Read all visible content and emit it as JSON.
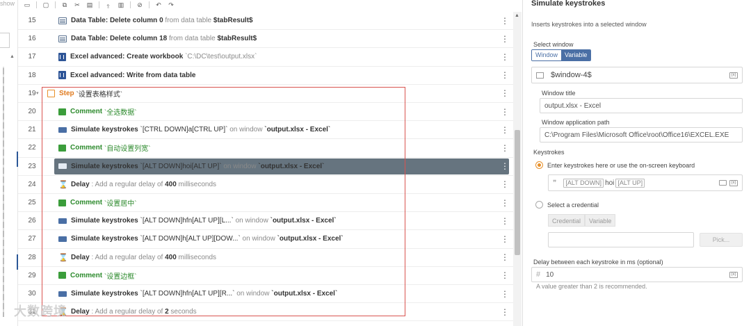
{
  "left": {
    "show_label": "show"
  },
  "rows": [
    {
      "num": "15",
      "icon": "table",
      "parts": [
        [
          "b",
          "Data Table: Delete column 0"
        ],
        [
          "g",
          " from data table "
        ],
        [
          "b",
          "$tabResult$"
        ]
      ]
    },
    {
      "num": "16",
      "icon": "table",
      "parts": [
        [
          "b",
          "Data Table: Delete column 18"
        ],
        [
          "g",
          " from data table "
        ],
        [
          "b",
          "$tabResult$"
        ]
      ]
    },
    {
      "num": "17",
      "icon": "excel",
      "parts": [
        [
          "b",
          "Excel advanced: Create workbook"
        ],
        [
          "g",
          " `C:\\DC\\test\\output.xlsx`"
        ]
      ]
    },
    {
      "num": "18",
      "icon": "excel",
      "parts": [
        [
          "b",
          "Excel advanced: Write from data table"
        ]
      ]
    },
    {
      "num": "19",
      "icon": "step",
      "caret": true,
      "parts": [
        [
          "o",
          "Step"
        ],
        [
          "n",
          " `设置表格样式`"
        ]
      ]
    },
    {
      "num": "20",
      "icon": "comment",
      "parts": [
        [
          "gr",
          "Comment"
        ],
        [
          "cs",
          " `全选数据`"
        ]
      ]
    },
    {
      "num": "21",
      "icon": "kb",
      "parts": [
        [
          "b",
          "Simulate keystrokes"
        ],
        [
          "n",
          " `[CTRL DOWN]a[CTRL UP]`"
        ],
        [
          "g",
          " on window "
        ],
        [
          "v",
          "`output.xlsx - Excel`"
        ]
      ]
    },
    {
      "num": "22",
      "icon": "comment",
      "parts": [
        [
          "gr",
          "Comment"
        ],
        [
          "cs",
          " `自动设置列宽`"
        ]
      ]
    },
    {
      "num": "23",
      "icon": "kb",
      "selected": true,
      "parts": [
        [
          "b",
          "Simulate keystrokes"
        ],
        [
          "n",
          " `[ALT DOWN]hoi[ALT UP]`"
        ],
        [
          "g",
          " on window "
        ],
        [
          "v",
          "`output.xlsx - Excel`"
        ]
      ]
    },
    {
      "num": "24",
      "icon": "delay",
      "parts": [
        [
          "b",
          "Delay"
        ],
        [
          "g",
          " : Add a regular delay of "
        ],
        [
          "v",
          "400"
        ],
        [
          "g",
          " milliseconds"
        ]
      ]
    },
    {
      "num": "25",
      "icon": "comment",
      "parts": [
        [
          "gr",
          "Comment"
        ],
        [
          "cs",
          " `设置居中`"
        ]
      ]
    },
    {
      "num": "26",
      "icon": "kb",
      "parts": [
        [
          "b",
          "Simulate keystrokes"
        ],
        [
          "n",
          " `[ALT DOWN]hfn[ALT UP][L...`"
        ],
        [
          "g",
          " on window "
        ],
        [
          "v",
          "`output.xlsx - Excel`"
        ]
      ]
    },
    {
      "num": "27",
      "icon": "kb",
      "parts": [
        [
          "b",
          "Simulate keystrokes"
        ],
        [
          "n",
          " `[ALT DOWN]h[ALT UP][DOW...`"
        ],
        [
          "g",
          " on window "
        ],
        [
          "v",
          "`output.xlsx - Excel`"
        ]
      ]
    },
    {
      "num": "28",
      "icon": "delay",
      "parts": [
        [
          "b",
          "Delay"
        ],
        [
          "g",
          " : Add a regular delay of "
        ],
        [
          "v",
          "400"
        ],
        [
          "g",
          " milliseconds"
        ]
      ]
    },
    {
      "num": "29",
      "icon": "comment",
      "parts": [
        [
          "gr",
          "Comment"
        ],
        [
          "cs",
          " `设置边框`"
        ]
      ]
    },
    {
      "num": "30",
      "icon": "kb",
      "parts": [
        [
          "b",
          "Simulate keystrokes"
        ],
        [
          "n",
          " `[ALT DOWN]hfn[ALT UP][R...`"
        ],
        [
          "g",
          " on window "
        ],
        [
          "v",
          "`output.xlsx - Excel`"
        ]
      ]
    },
    {
      "num": "31",
      "icon": "delay",
      "parts": [
        [
          "b",
          "Delay"
        ],
        [
          "g",
          " : Add a regular delay of "
        ],
        [
          "v",
          "2"
        ],
        [
          "g",
          " seconds"
        ]
      ]
    }
  ],
  "watermark": "大数跨境",
  "panel": {
    "title": "Simulate keystrokes",
    "description": "Inserts keystrokes into a selected window",
    "select_window_label": "Select window",
    "seg_window": "Window",
    "seg_variable": "Variable",
    "window_var": "$window-4$",
    "window_title_label": "Window title",
    "window_title_value": "output.xlsx - Excel",
    "app_path_label": "Window application path",
    "app_path_value": "C:\\Program Files\\Microsoft Office\\root\\Office16\\EXCEL.EXE",
    "keystrokes_label": "Keystrokes",
    "radio_enter": "Enter keystrokes here or use the on-screen keyboard",
    "ks_chip1": "[ALT DOWN]",
    "ks_mid": "hoi",
    "ks_chip2": "[ALT UP]",
    "radio_credential": "Select a credential",
    "cred_seg1": "Credential",
    "cred_seg2": "Variable",
    "pick_label": "Pick...",
    "delay_label": "Delay between each keystroke in ms (optional)",
    "delay_value": "10",
    "delay_hint": "A value greater than 2 is recommended."
  }
}
